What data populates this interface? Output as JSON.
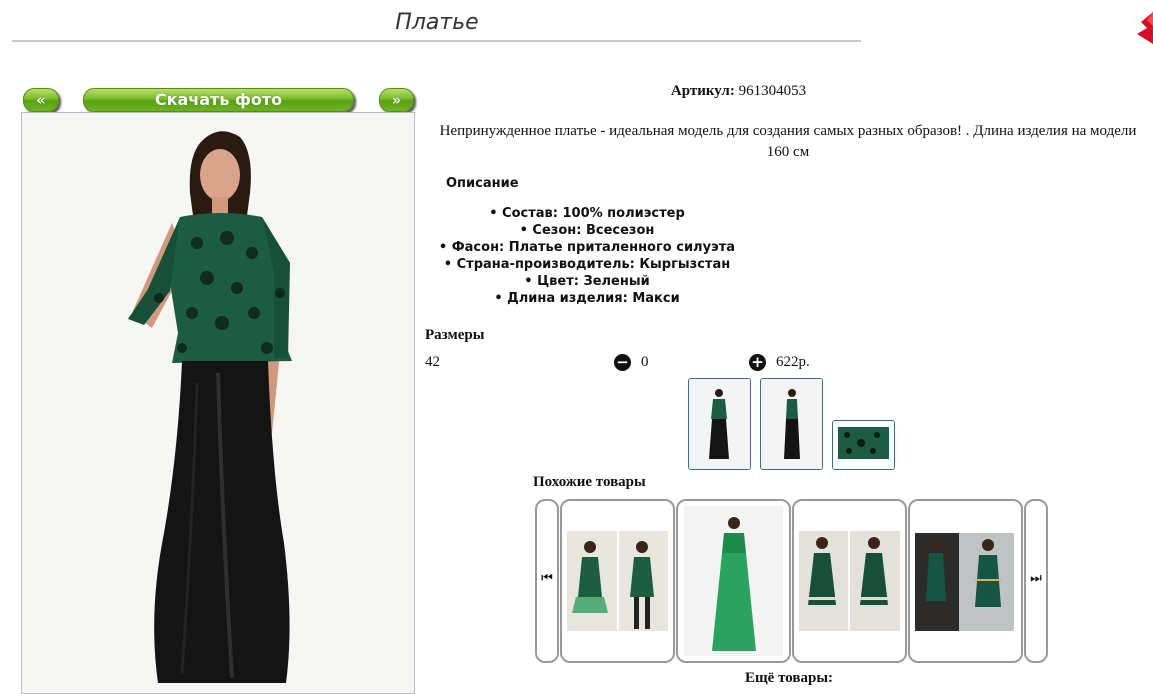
{
  "header": {
    "title": "Платье"
  },
  "photo_nav": {
    "prev_label": "«",
    "download_label": "Скачать фото",
    "next_label": "»"
  },
  "product": {
    "sku_label": "Артикул:",
    "sku_value": "961304053",
    "description": "Непринужденное платье - идеальная модель для создания самых разных образов! . Длина изделия на модели 160 см",
    "description_heading": "Описание",
    "properties": [
      "Состав: 100% полиэстер",
      "Сезон: Всесезон",
      "Фасон: Платье приталенного силуэта",
      "Страна-производитель: Кыргызстан",
      "Цвет: Зеленый",
      "Длина изделия: Макси"
    ],
    "sizes_heading": "Размеры",
    "size": "42",
    "quantity": "0",
    "price": "622р.",
    "minus_symbol": "−",
    "plus_symbol": "+"
  },
  "similar": {
    "heading": "Похожие товары",
    "prev_symbol": "⏮",
    "next_symbol": "⏭"
  },
  "more": {
    "heading": "Ещё товары:"
  },
  "colors": {
    "button_green": "#6cb520",
    "dress_green": "#1f6b4f",
    "thumb_border": "#3a6a8c"
  },
  "icons": [
    "logo-icon",
    "minus-circle-icon",
    "plus-circle-icon",
    "skip-back-icon",
    "skip-forward-icon"
  ]
}
